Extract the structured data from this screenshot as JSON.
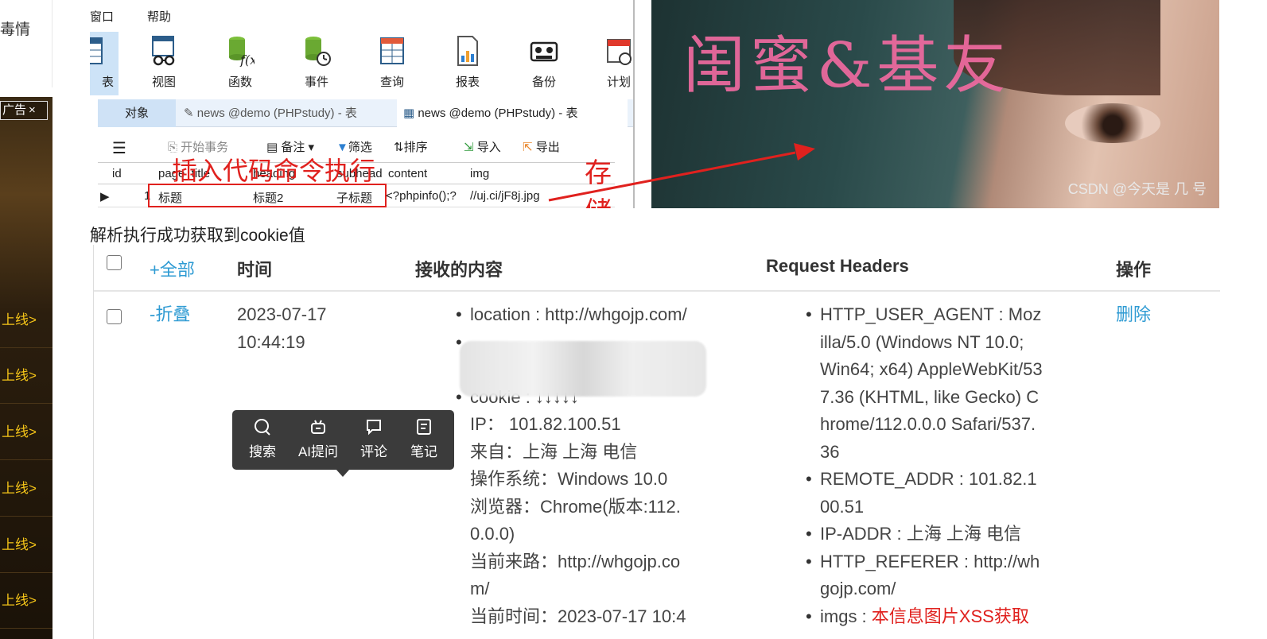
{
  "left_sidebar": {
    "cut_text": "毒情",
    "ad_badge": "广告",
    "ad_close": "×",
    "ad_links": [
      "上线>",
      "上线>",
      "上线>",
      "上线>",
      "上线>",
      "上线>"
    ]
  },
  "navicat": {
    "menu": [
      "窗口",
      "帮助"
    ],
    "toolbar": [
      {
        "label": "表",
        "icon": "table-icon"
      },
      {
        "label": "视图",
        "icon": "view-icon"
      },
      {
        "label": "函数",
        "icon": "function-icon"
      },
      {
        "label": "事件",
        "icon": "event-icon"
      },
      {
        "label": "查询",
        "icon": "query-icon"
      },
      {
        "label": "报表",
        "icon": "report-icon"
      },
      {
        "label": "备份",
        "icon": "backup-icon"
      },
      {
        "label": "计划",
        "icon": "schedule-icon"
      }
    ],
    "tabs": {
      "object": "对象",
      "tab1": "news @demo (PHPstudy) - 表",
      "tab2": "news @demo (PHPstudy) - 表"
    },
    "grid_toolbar": [
      "开始事务",
      "备注",
      "筛选",
      "排序",
      "导入",
      "导出"
    ],
    "columns": [
      "id",
      "page_title",
      "heading",
      "subhead",
      "content",
      "img"
    ],
    "row": {
      "id": "1",
      "page_title": "标题",
      "heading": "标题2",
      "subhead": "子标题",
      "content": "<?phpinfo();?",
      "img": "//uj.ci/jF8j.jpg"
    },
    "annotation_insert": "插入代码命令执行",
    "annotation_xss": "存储型XSS"
  },
  "photo": {
    "sign_text": "闺蜜&基友",
    "watermark": "CSDN @今天是 几 号"
  },
  "caption": "解析执行成功获取到cookie值",
  "xss_table": {
    "headers": {
      "all": "+全部",
      "time": "时间",
      "content": "接收的内容",
      "request_headers": "Request Headers",
      "action": "操作"
    },
    "row": {
      "fold": "-折叠",
      "date": "2023-07-17",
      "time": "10:44:19",
      "location": "location : http://whgojp.com/",
      "cookie": "cookie : ↓↓↓↓↓",
      "ip": "IP：  101.82.100.51",
      "from": "来自：上海 上海 电信",
      "os": "操作系统：Windows 10.0",
      "browser": "浏览器：Chrome(版本:112.",
      "browser2": "0.0.0)",
      "referer": "当前来路：http://whgojp.co",
      "referer2": "m/",
      "now": "当前时间：2023-07-17 10:4",
      "ua": "HTTP_USER_AGENT : Moz",
      "ua2": "illa/5.0 (Windows NT 10.0;",
      "ua3": "Win64; x64) AppleWebKit/53",
      "ua4": "7.36 (KHTML, like Gecko) C",
      "ua5": "hrome/112.0.0.0 Safari/537.",
      "ua6": "36",
      "remote": "REMOTE_ADDR : 101.82.1",
      "remote2": "00.51",
      "ipaddr": "IP-ADDR : 上海 上海 电信",
      "hreferer": "HTTP_REFERER : http://wh",
      "hreferer2": "gojp.com/",
      "imgs_label": "imgs : ",
      "imgs_value": "本信息图片XSS获取",
      "delete": "删除"
    }
  },
  "popup_menu": [
    {
      "label": "搜索",
      "icon": "search-icon"
    },
    {
      "label": "AI提问",
      "icon": "ai-robot-icon"
    },
    {
      "label": "评论",
      "icon": "comment-icon"
    },
    {
      "label": "笔记",
      "icon": "note-icon"
    }
  ],
  "colors": {
    "link_blue": "#2f9bd3",
    "annotation_red": "#e0211e",
    "ad_gold": "#f5c518",
    "popup_bg": "#3b3b3b"
  }
}
